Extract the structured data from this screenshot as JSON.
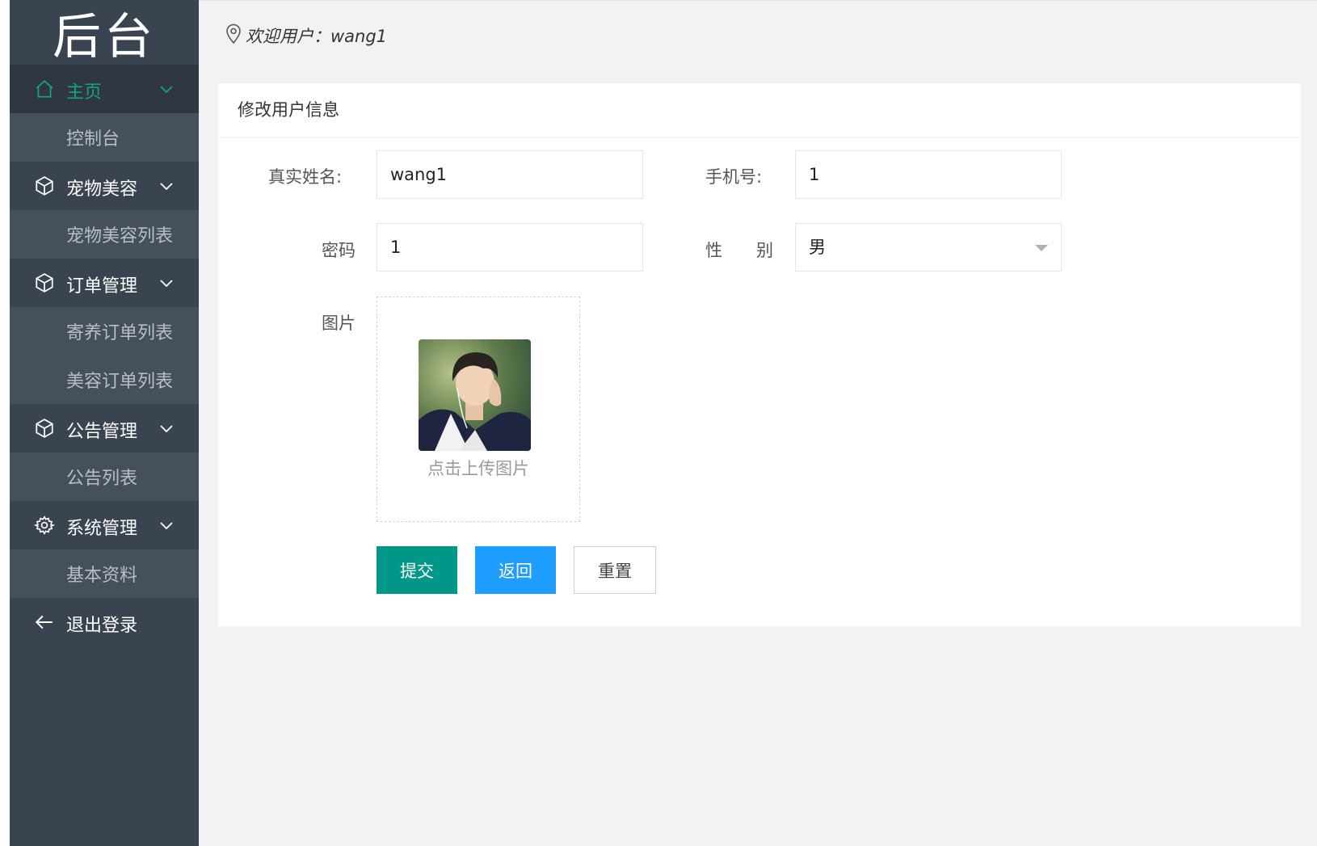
{
  "sidebar": {
    "logo": "后台",
    "menu": [
      {
        "label": "主页",
        "icon": "home-icon",
        "active": true,
        "children": [
          "控制台"
        ]
      },
      {
        "label": "宠物美容",
        "icon": "cube-icon",
        "children": [
          "宠物美容列表"
        ]
      },
      {
        "label": "订单管理",
        "icon": "cube-icon",
        "children": [
          "寄养订单列表",
          "美容订单列表"
        ]
      },
      {
        "label": "公告管理",
        "icon": "cube-icon",
        "children": [
          "公告列表"
        ]
      },
      {
        "label": "系统管理",
        "icon": "gear-icon",
        "children": [
          "基本资料"
        ]
      }
    ],
    "logout": "退出登录"
  },
  "topbar": {
    "welcome": "欢迎用户：wang1"
  },
  "form": {
    "title": "修改用户信息",
    "realname_label": "真实姓名:",
    "realname_value": "wang1",
    "phone_label": "手机号:",
    "phone_value": "1",
    "password_label": "密码",
    "password_value": "1",
    "gender_label": "性　　别",
    "gender_value": "男",
    "image_label": "图片",
    "upload_text": "点击上传图片",
    "submit_label": "提交",
    "back_label": "返回",
    "reset_label": "重置"
  },
  "colors": {
    "sidebar_bg": "#3a4450",
    "submenu_bg": "#45505c",
    "active_color": "#13a384",
    "submit_bg": "#009688",
    "back_bg": "#1e9fff"
  }
}
